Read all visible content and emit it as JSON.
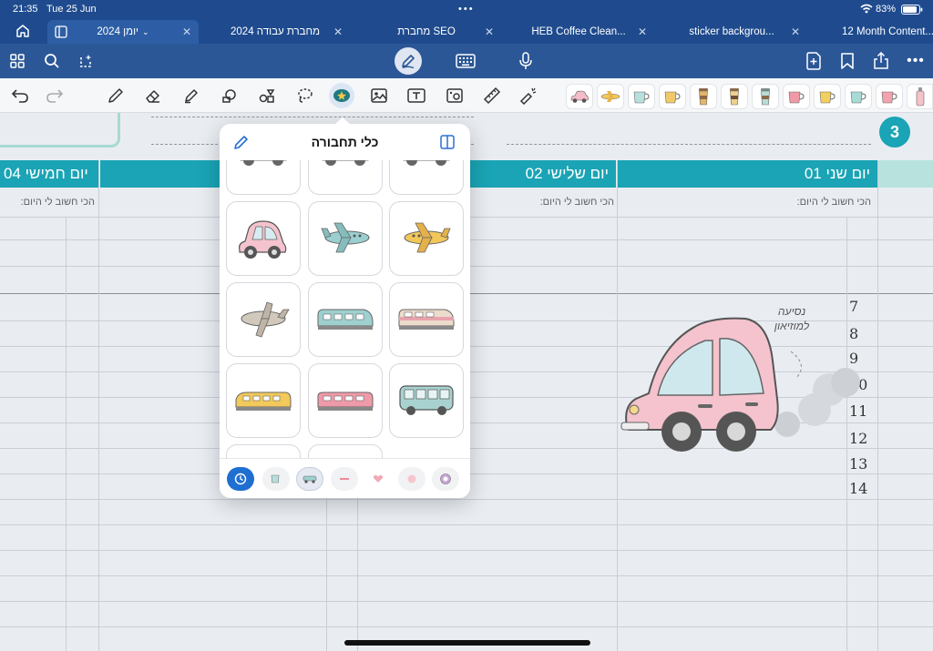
{
  "status": {
    "time": "21:35",
    "date": "Tue 25 Jun",
    "battery": "83%"
  },
  "tabs": [
    {
      "label": "יומן 2024"
    },
    {
      "label": "מחברת עבודה 2024"
    },
    {
      "label": "מחברת SEO"
    },
    {
      "label": "HEB Coffee Clean..."
    },
    {
      "label": "sticker backgrou..."
    },
    {
      "label": "12 Month Content..."
    }
  ],
  "popup": {
    "title": "כלי תחבורה",
    "stickers": [
      "pink-car-sticker",
      "blue-plane-sticker",
      "yellow-plane-sticker",
      "gray-plane-sticker",
      "blue-train-sticker",
      "pink-train-sticker",
      "yellow-train-sticker",
      "pink-train-sticker",
      "blue-bus-sticker"
    ],
    "categories": [
      "recent",
      "coffee",
      "transport",
      "ribbon",
      "heart",
      "circle",
      "badge"
    ]
  },
  "planner": {
    "page_number": "3",
    "days": [
      {
        "label": "יום חמישי 04"
      },
      {
        "label": "יום שלישי 02"
      },
      {
        "label": "יום שני 01"
      }
    ],
    "important_label": "הכי חשוב לי היום:",
    "handwriting": "נסיעה למוזיאון",
    "hours": [
      "7",
      "8",
      "9",
      "10",
      "11",
      "12",
      "13",
      "14"
    ]
  },
  "colors": {
    "accent": "#1aa4b5",
    "toolbar": "#2b5797",
    "tabbar": "#1f4b8e"
  }
}
